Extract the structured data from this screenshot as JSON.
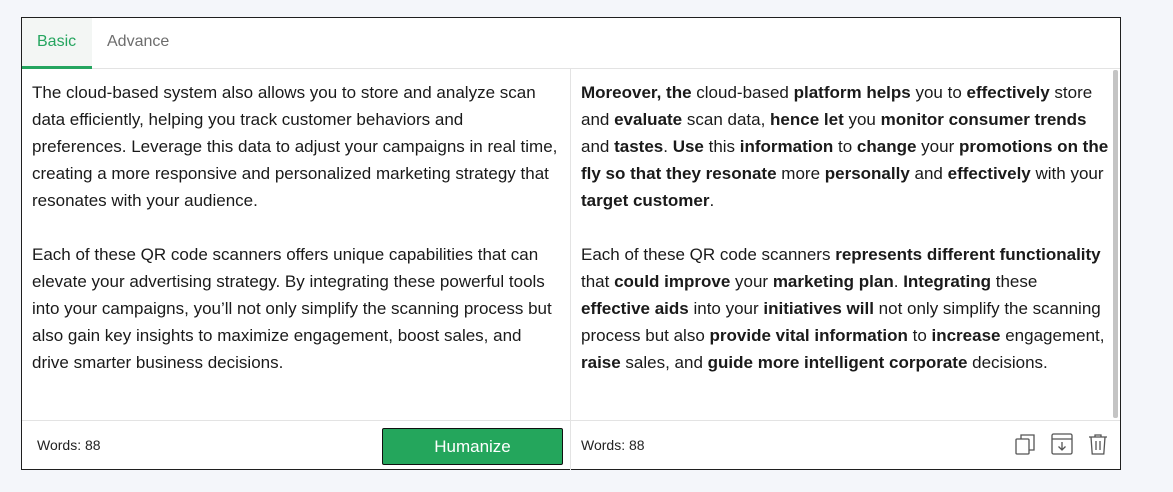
{
  "tabs": [
    {
      "label": "Basic"
    },
    {
      "label": "Advance"
    }
  ],
  "input": {
    "paragraphs": [
      "The cloud-based system also allows you to store and analyze scan data efficiently, helping you track customer behaviors and preferences. Leverage this data to adjust your campaigns in real time, creating a more responsive and personalized marketing strategy that resonates with your audience.",
      "Each of these QR code scanners offers unique capabilities that can elevate your advertising strategy. By integrating these powerful tools into your campaigns, you’ll not only simplify the scanning process but also gain key insights to maximize engagement, boost sales, and drive smarter business decisions."
    ],
    "word_count": "Words: 88",
    "action_label": "Humanize"
  },
  "output": {
    "paragraphs": [
      [
        {
          "t": "Moreover, the",
          "b": true
        },
        {
          "t": " cloud-based ",
          "b": false
        },
        {
          "t": "platform helps",
          "b": true
        },
        {
          "t": " you to ",
          "b": false
        },
        {
          "t": "effectively",
          "b": true
        },
        {
          "t": " store and ",
          "b": false
        },
        {
          "t": "evaluate",
          "b": true
        },
        {
          "t": " scan data, ",
          "b": false
        },
        {
          "t": "hence let",
          "b": true
        },
        {
          "t": " you ",
          "b": false
        },
        {
          "t": "monitor consumer trends",
          "b": true
        },
        {
          "t": " and ",
          "b": false
        },
        {
          "t": "tastes",
          "b": true
        },
        {
          "t": ". ",
          "b": false
        },
        {
          "t": "Use",
          "b": true
        },
        {
          "t": " this ",
          "b": false
        },
        {
          "t": "information",
          "b": true
        },
        {
          "t": " to ",
          "b": false
        },
        {
          "t": "change",
          "b": true
        },
        {
          "t": " your ",
          "b": false
        },
        {
          "t": "promotions on the fly so that they resonate",
          "b": true
        },
        {
          "t": " more ",
          "b": false
        },
        {
          "t": "personally",
          "b": true
        },
        {
          "t": " and ",
          "b": false
        },
        {
          "t": "effectively",
          "b": true
        },
        {
          "t": " with your ",
          "b": false
        },
        {
          "t": "target customer",
          "b": true
        },
        {
          "t": ".",
          "b": false
        }
      ],
      [
        {
          "t": "Each of these QR code scanners ",
          "b": false
        },
        {
          "t": "represents different functionality",
          "b": true
        },
        {
          "t": " that ",
          "b": false
        },
        {
          "t": "could improve",
          "b": true
        },
        {
          "t": " your ",
          "b": false
        },
        {
          "t": "marketing plan",
          "b": true
        },
        {
          "t": ". ",
          "b": false
        },
        {
          "t": "Integrating",
          "b": true
        },
        {
          "t": " these ",
          "b": false
        },
        {
          "t": "effective aids",
          "b": true
        },
        {
          "t": " into your ",
          "b": false
        },
        {
          "t": "initiatives will",
          "b": true
        },
        {
          "t": " not only simplify the scanning process but also ",
          "b": false
        },
        {
          "t": "provide vital information",
          "b": true
        },
        {
          "t": " to ",
          "b": false
        },
        {
          "t": "increase",
          "b": true
        },
        {
          "t": " engagement, ",
          "b": false
        },
        {
          "t": "raise",
          "b": true
        },
        {
          "t": " sales, and ",
          "b": false
        },
        {
          "t": "guide more intelligent corporate",
          "b": true
        },
        {
          "t": " decisions.",
          "b": false
        }
      ]
    ],
    "word_count": "Words: 88",
    "icons": [
      "copy-icon",
      "download-icon",
      "trash-icon"
    ]
  },
  "colors": {
    "accent": "#25a55f",
    "button": "#24a65c",
    "border": "#1f1f1f",
    "background": "#f4f6fa"
  }
}
